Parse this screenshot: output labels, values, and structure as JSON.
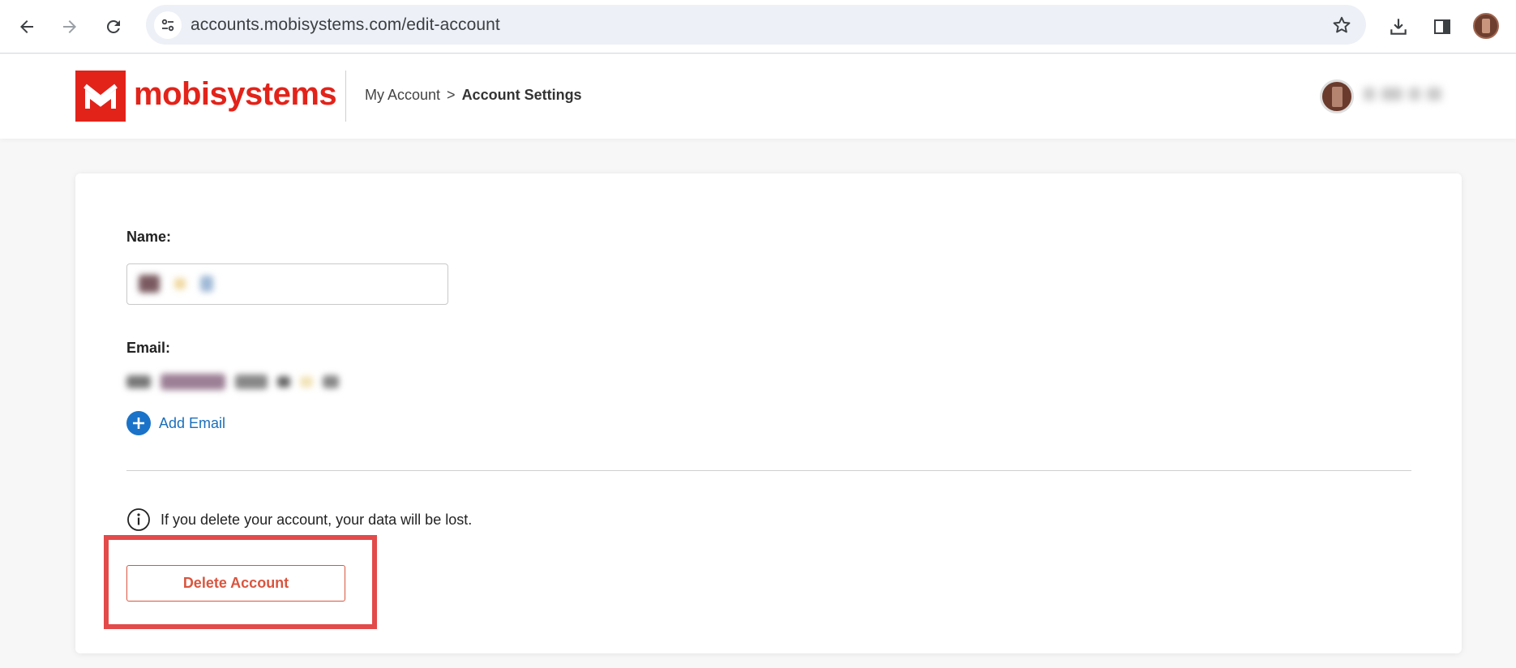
{
  "browser": {
    "url": "accounts.mobisystems.com/edit-account",
    "icons": {
      "back": "arrow-left-icon",
      "forward": "arrow-right-icon",
      "reload": "reload-icon",
      "site_settings": "tune-icon",
      "bookmark": "star-icon",
      "downloads": "download-icon",
      "side_panel": "side-panel-icon"
    }
  },
  "header": {
    "logo_text": "mobisystems",
    "brand_color": "#e2231a",
    "breadcrumb": {
      "parent": "My Account",
      "separator": ">",
      "current": "Account Settings"
    }
  },
  "account": {
    "name_label": "Name:",
    "email_label": "Email:",
    "add_email_label": "Add Email",
    "warning_text": "If you delete your account, your data will be lost.",
    "delete_button_label": "Delete Account",
    "accent_color": "#1a73c8",
    "danger_color": "#d9553f"
  }
}
